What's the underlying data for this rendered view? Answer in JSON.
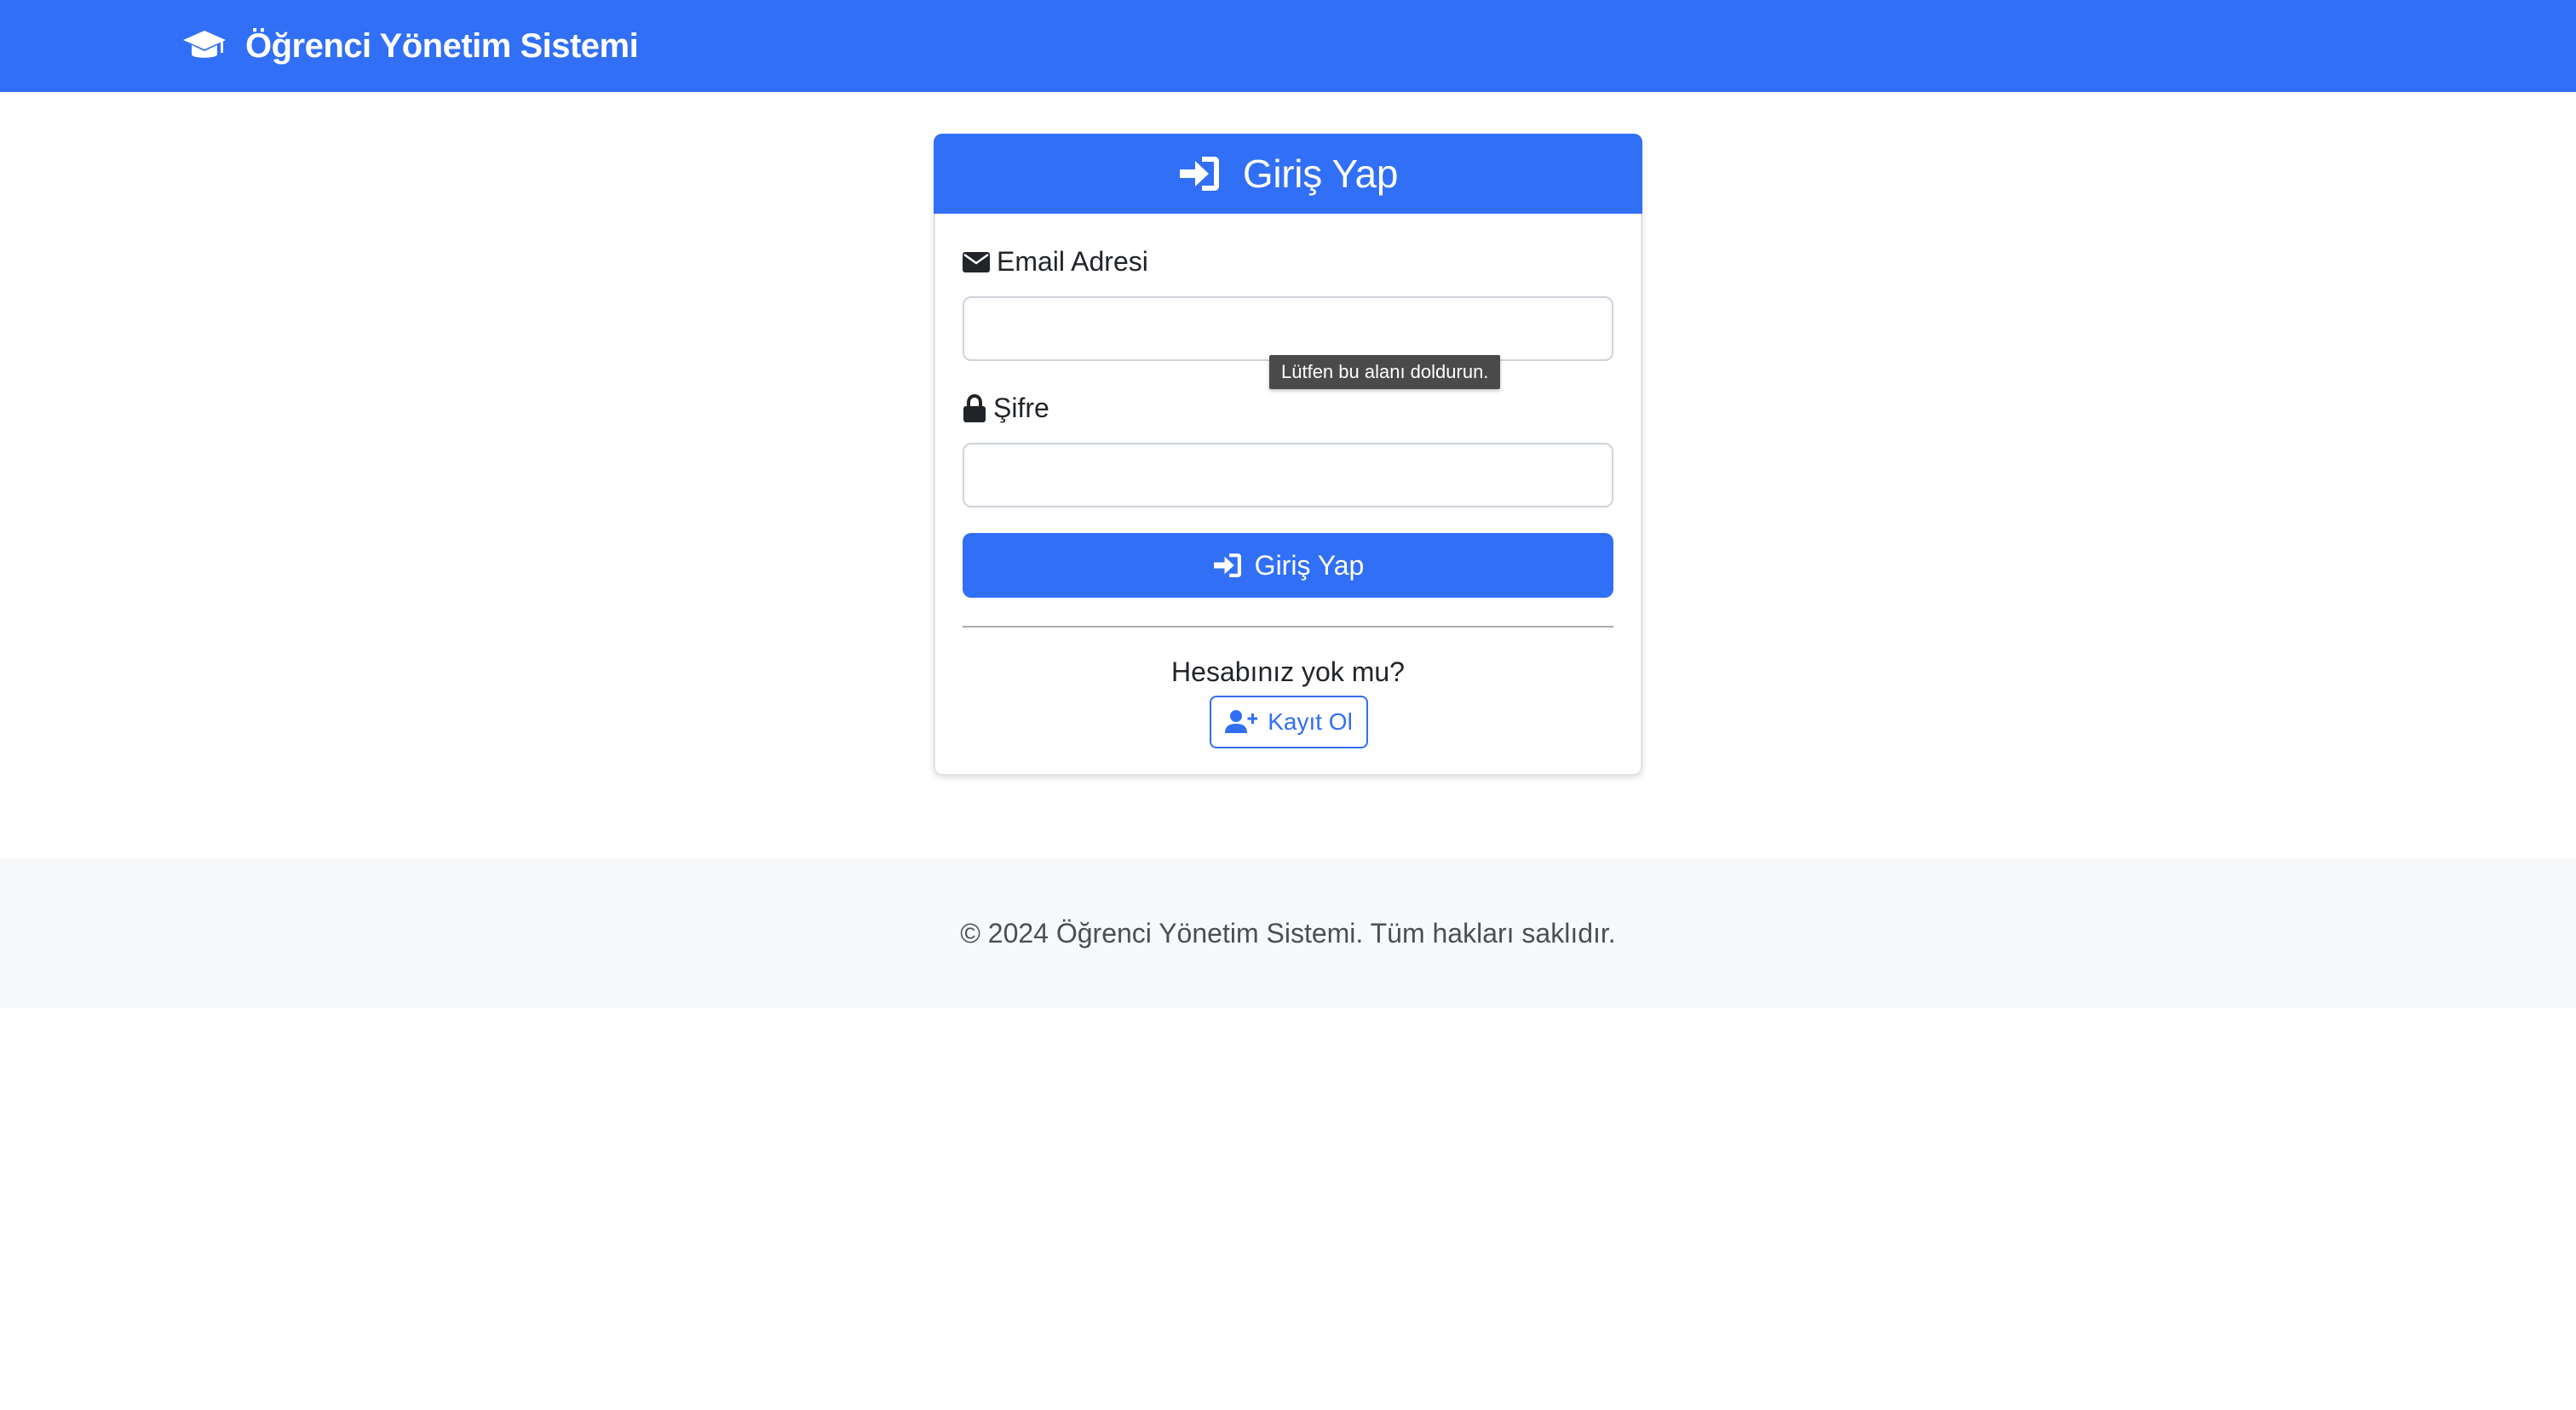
{
  "navbar": {
    "brand": "Öğrenci Yönetim Sistemi",
    "brand_icon": "graduation-cap-icon",
    "bg_color": "#316ff6"
  },
  "login_card": {
    "title": "Giriş Yap",
    "title_icon": "sign-in-icon",
    "email": {
      "label": "Email Adresi",
      "icon": "envelope-icon",
      "value": "",
      "validation_tooltip": "Lütfen bu alanı doldurun."
    },
    "password": {
      "label": "Şifre",
      "icon": "lock-icon",
      "value": ""
    },
    "submit_label": "Giriş Yap",
    "no_account_text": "Hesabınız yok mu?",
    "register_label": "Kayıt Ol",
    "register_icon": "user-plus-icon"
  },
  "footer": {
    "text": "© 2024 Öğrenci Yönetim Sistemi. Tüm hakları saklıdır."
  },
  "colors": {
    "primary": "#316ff6",
    "footer_bg": "#f8f9fa"
  }
}
